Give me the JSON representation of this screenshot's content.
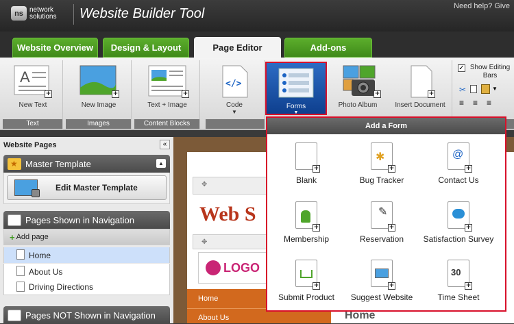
{
  "app": {
    "logo_mark": "ns",
    "logo_text": "network solutions",
    "title": "Website Builder Tool",
    "help": "Need help? Give"
  },
  "tabs": [
    {
      "label": "Website Overview"
    },
    {
      "label": "Design & Layout"
    },
    {
      "label": "Page Editor"
    },
    {
      "label": "Add-ons"
    }
  ],
  "ribbon": {
    "groups": [
      {
        "footer": "Text"
      },
      {
        "footer": "Images"
      },
      {
        "footer": "Content Blocks"
      }
    ],
    "buttons": {
      "new_text": "New Text",
      "new_image": "New Image",
      "text_image": "Text + Image",
      "code": "Code",
      "forms": "Forms",
      "photo_album": "Photo Album",
      "insert_document": "Insert Document"
    },
    "show_editing": "Show Editing Bars",
    "show_editing_checked": true
  },
  "dropdown": {
    "title": "Add a Form",
    "items": [
      {
        "label": "Blank"
      },
      {
        "label": "Bug Tracker"
      },
      {
        "label": "Contact Us"
      },
      {
        "label": "Membership"
      },
      {
        "label": "Reservation"
      },
      {
        "label": "Satisfaction Survey"
      },
      {
        "label": "Submit Product"
      },
      {
        "label": "Suggest Website"
      },
      {
        "label": "Time Sheet"
      }
    ]
  },
  "sidebar": {
    "title": "Website Pages",
    "master": {
      "header": "Master Template",
      "edit_button": "Edit Master Template"
    },
    "shown": {
      "header": "Pages Shown in Navigation",
      "add_page": "Add page",
      "pages": [
        {
          "label": "Home",
          "selected": true
        },
        {
          "label": "About Us"
        },
        {
          "label": "Driving Directions"
        }
      ]
    },
    "not_shown": {
      "header": "Pages NOT Shown in Navigation"
    }
  },
  "preview": {
    "site_title": "Web S",
    "logo_text": "LOGO",
    "nav": [
      {
        "label": "Home"
      },
      {
        "label": "About Us"
      }
    ],
    "page_heading": "Home"
  },
  "colors": {
    "accent_green": "#4a9b22",
    "highlight_red": "#d8102a",
    "selected_blue": "#cde0fa",
    "site_red": "#b8361c"
  }
}
